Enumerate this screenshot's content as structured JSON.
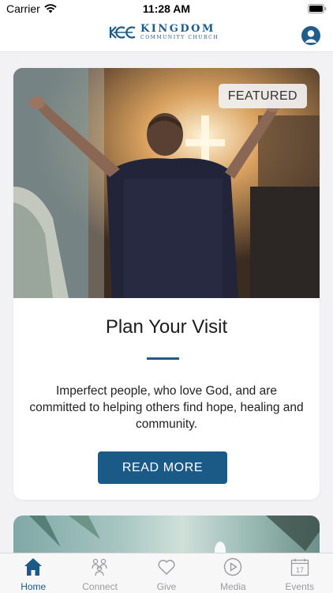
{
  "status_bar": {
    "carrier": "Carrier",
    "time": "11:28 AM"
  },
  "header": {
    "logo_title": "KINGDOM",
    "logo_subtitle": "COMMUNITY CHURCH",
    "brand_color": "#1e5b88"
  },
  "featured_card": {
    "badge": "FEATURED",
    "title": "Plan Your Visit",
    "description": "Imperfect people, who love God, and are committed to helping others find hope, healing and community.",
    "button_label": "READ MORE"
  },
  "tab_bar": {
    "tabs": [
      {
        "label": "Home",
        "icon": "home-icon",
        "active": true
      },
      {
        "label": "Connect",
        "icon": "people-icon",
        "active": false
      },
      {
        "label": "Give",
        "icon": "heart-icon",
        "active": false
      },
      {
        "label": "Media",
        "icon": "play-icon",
        "active": false
      },
      {
        "label": "Events",
        "icon": "calendar-icon",
        "active": false,
        "badge_text": "17"
      }
    ]
  },
  "colors": {
    "accent": "#1b5a86",
    "inactive_tab": "#9b9b9f",
    "background": "#f2f2f4"
  }
}
